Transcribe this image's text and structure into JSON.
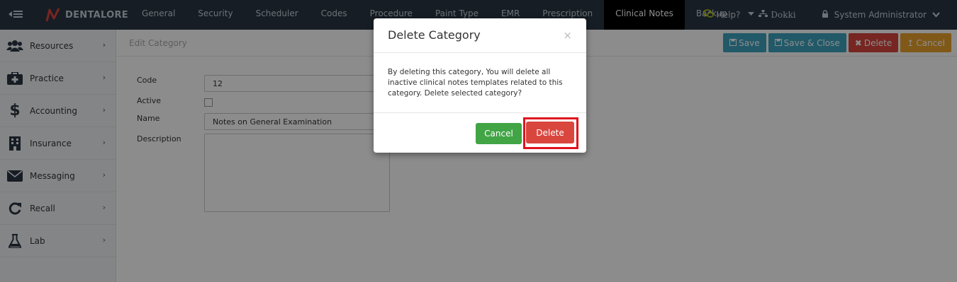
{
  "brand": {
    "name": "DENTALORE",
    "accent": "#d9463e"
  },
  "nav": {
    "items": [
      {
        "label": "General"
      },
      {
        "label": "Security"
      },
      {
        "label": "Scheduler"
      },
      {
        "label": "Codes"
      },
      {
        "label": "Procedure"
      },
      {
        "label": "Paint Type"
      },
      {
        "label": "EMR"
      },
      {
        "label": "Prescription"
      },
      {
        "label": "Clinical Notes",
        "active": true
      },
      {
        "label": "Backup"
      }
    ],
    "help": "Help?",
    "location": "Dokki",
    "user": "System Administrator"
  },
  "sidebar": {
    "items": [
      {
        "label": "Resources",
        "icon": "users-icon"
      },
      {
        "label": "Practice",
        "icon": "medkit-icon"
      },
      {
        "label": "Accounting",
        "icon": "dollar-icon"
      },
      {
        "label": "Insurance",
        "icon": "building-icon"
      },
      {
        "label": "Messaging",
        "icon": "envelope-icon"
      },
      {
        "label": "Recall",
        "icon": "refresh-icon"
      },
      {
        "label": "Lab",
        "icon": "flask-icon"
      }
    ]
  },
  "page": {
    "title": "Edit Category",
    "actions": {
      "save": "Save",
      "save_close": "Save & Close",
      "delete": "Delete",
      "cancel": "Cancel"
    }
  },
  "form": {
    "code_label": "Code",
    "code_value": "12",
    "active_label": "Active",
    "active_checked": false,
    "name_label": "Name",
    "name_value": "Notes on General Examination",
    "description_label": "Description",
    "description_value": ""
  },
  "modal": {
    "title": "Delete Category",
    "close": "×",
    "message": "By deleting this category, You will delete all inactive clinical notes templates related to this category. Delete selected category?",
    "cancel_label": "Cancel",
    "delete_label": "Delete"
  },
  "colors": {
    "topbar": "#2b3643",
    "save": "#3ca3be",
    "delete": "#d9463e",
    "cancel_orange": "#e9a32c",
    "cancel_green": "#41a445",
    "highlight": "#e0131e"
  }
}
